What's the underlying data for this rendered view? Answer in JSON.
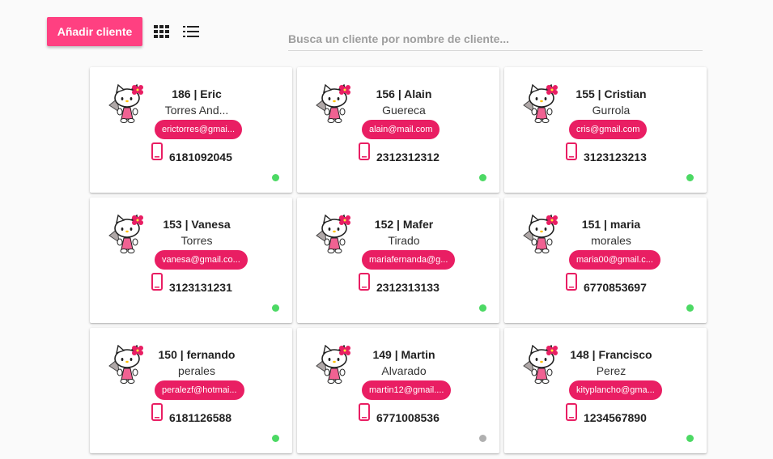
{
  "toolbar": {
    "add_label": "Añadir cliente",
    "grid_icon": "grid-view-icon",
    "list_icon": "list-view-icon"
  },
  "search": {
    "placeholder": "Busca un cliente por nombre de cliente..."
  },
  "colors": {
    "accent": "#ff4081",
    "badge": "#e91e63",
    "online": "#4cd964",
    "offline": "#b0b0b0"
  },
  "clients": [
    {
      "name": "186 | Eric",
      "lastname": "Torres And...",
      "email": "erictorres@gmai...",
      "phone": "6181092045",
      "status": "online"
    },
    {
      "name": "156 | Alain",
      "lastname": "Guereca",
      "email": "alain@mail.com",
      "phone": "2312312312",
      "status": "online"
    },
    {
      "name": "155 | Cristian",
      "lastname": "Gurrola",
      "email": "cris@gmail.com",
      "phone": "3123123213",
      "status": "online"
    },
    {
      "name": "153 | Vanesa",
      "lastname": "Torres",
      "email": "vanesa@gmail.co...",
      "phone": "3123131231",
      "status": "online"
    },
    {
      "name": "152 | Mafer",
      "lastname": "Tirado",
      "email": "mariafernanda@g...",
      "phone": "2312313133",
      "status": "online"
    },
    {
      "name": "151 | maria",
      "lastname": "morales",
      "email": "maria00@gmail.c...",
      "phone": "6770853697",
      "status": "online"
    },
    {
      "name": "150 | fernando",
      "lastname": "perales",
      "email": "peralezf@hotmai...",
      "phone": "6181126588",
      "status": "online"
    },
    {
      "name": "149 | Martin",
      "lastname": "Alvarado",
      "email": "martin12@gmail....",
      "phone": "6771008536",
      "status": "offline"
    },
    {
      "name": "148 | Francisco",
      "lastname": "Perez",
      "email": "kityplancho@gma...",
      "phone": "1234567890",
      "status": "online"
    }
  ]
}
